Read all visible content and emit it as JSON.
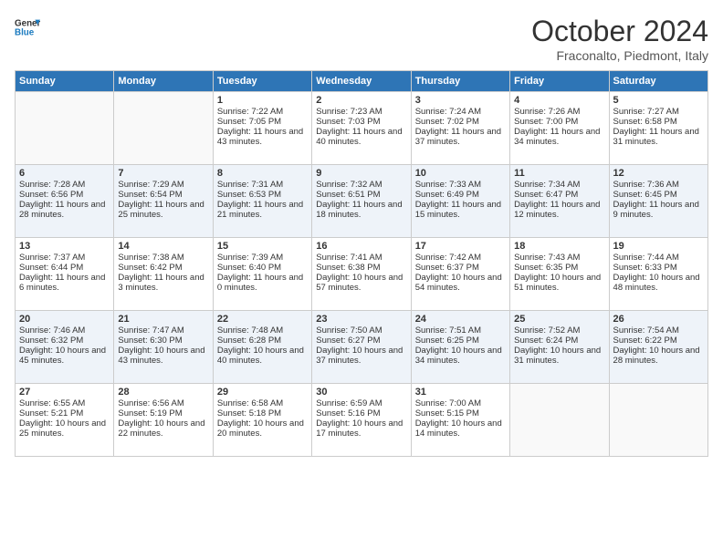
{
  "header": {
    "logo_line1": "General",
    "logo_line2": "Blue",
    "month": "October 2024",
    "location": "Fraconalto, Piedmont, Italy"
  },
  "weekdays": [
    "Sunday",
    "Monday",
    "Tuesday",
    "Wednesday",
    "Thursday",
    "Friday",
    "Saturday"
  ],
  "weeks": [
    [
      {
        "day": "",
        "sunrise": "",
        "sunset": "",
        "daylight": ""
      },
      {
        "day": "",
        "sunrise": "",
        "sunset": "",
        "daylight": ""
      },
      {
        "day": "1",
        "sunrise": "Sunrise: 7:22 AM",
        "sunset": "Sunset: 7:05 PM",
        "daylight": "Daylight: 11 hours and 43 minutes."
      },
      {
        "day": "2",
        "sunrise": "Sunrise: 7:23 AM",
        "sunset": "Sunset: 7:03 PM",
        "daylight": "Daylight: 11 hours and 40 minutes."
      },
      {
        "day": "3",
        "sunrise": "Sunrise: 7:24 AM",
        "sunset": "Sunset: 7:02 PM",
        "daylight": "Daylight: 11 hours and 37 minutes."
      },
      {
        "day": "4",
        "sunrise": "Sunrise: 7:26 AM",
        "sunset": "Sunset: 7:00 PM",
        "daylight": "Daylight: 11 hours and 34 minutes."
      },
      {
        "day": "5",
        "sunrise": "Sunrise: 7:27 AM",
        "sunset": "Sunset: 6:58 PM",
        "daylight": "Daylight: 11 hours and 31 minutes."
      }
    ],
    [
      {
        "day": "6",
        "sunrise": "Sunrise: 7:28 AM",
        "sunset": "Sunset: 6:56 PM",
        "daylight": "Daylight: 11 hours and 28 minutes."
      },
      {
        "day": "7",
        "sunrise": "Sunrise: 7:29 AM",
        "sunset": "Sunset: 6:54 PM",
        "daylight": "Daylight: 11 hours and 25 minutes."
      },
      {
        "day": "8",
        "sunrise": "Sunrise: 7:31 AM",
        "sunset": "Sunset: 6:53 PM",
        "daylight": "Daylight: 11 hours and 21 minutes."
      },
      {
        "day": "9",
        "sunrise": "Sunrise: 7:32 AM",
        "sunset": "Sunset: 6:51 PM",
        "daylight": "Daylight: 11 hours and 18 minutes."
      },
      {
        "day": "10",
        "sunrise": "Sunrise: 7:33 AM",
        "sunset": "Sunset: 6:49 PM",
        "daylight": "Daylight: 11 hours and 15 minutes."
      },
      {
        "day": "11",
        "sunrise": "Sunrise: 7:34 AM",
        "sunset": "Sunset: 6:47 PM",
        "daylight": "Daylight: 11 hours and 12 minutes."
      },
      {
        "day": "12",
        "sunrise": "Sunrise: 7:36 AM",
        "sunset": "Sunset: 6:45 PM",
        "daylight": "Daylight: 11 hours and 9 minutes."
      }
    ],
    [
      {
        "day": "13",
        "sunrise": "Sunrise: 7:37 AM",
        "sunset": "Sunset: 6:44 PM",
        "daylight": "Daylight: 11 hours and 6 minutes."
      },
      {
        "day": "14",
        "sunrise": "Sunrise: 7:38 AM",
        "sunset": "Sunset: 6:42 PM",
        "daylight": "Daylight: 11 hours and 3 minutes."
      },
      {
        "day": "15",
        "sunrise": "Sunrise: 7:39 AM",
        "sunset": "Sunset: 6:40 PM",
        "daylight": "Daylight: 11 hours and 0 minutes."
      },
      {
        "day": "16",
        "sunrise": "Sunrise: 7:41 AM",
        "sunset": "Sunset: 6:38 PM",
        "daylight": "Daylight: 10 hours and 57 minutes."
      },
      {
        "day": "17",
        "sunrise": "Sunrise: 7:42 AM",
        "sunset": "Sunset: 6:37 PM",
        "daylight": "Daylight: 10 hours and 54 minutes."
      },
      {
        "day": "18",
        "sunrise": "Sunrise: 7:43 AM",
        "sunset": "Sunset: 6:35 PM",
        "daylight": "Daylight: 10 hours and 51 minutes."
      },
      {
        "day": "19",
        "sunrise": "Sunrise: 7:44 AM",
        "sunset": "Sunset: 6:33 PM",
        "daylight": "Daylight: 10 hours and 48 minutes."
      }
    ],
    [
      {
        "day": "20",
        "sunrise": "Sunrise: 7:46 AM",
        "sunset": "Sunset: 6:32 PM",
        "daylight": "Daylight: 10 hours and 45 minutes."
      },
      {
        "day": "21",
        "sunrise": "Sunrise: 7:47 AM",
        "sunset": "Sunset: 6:30 PM",
        "daylight": "Daylight: 10 hours and 43 minutes."
      },
      {
        "day": "22",
        "sunrise": "Sunrise: 7:48 AM",
        "sunset": "Sunset: 6:28 PM",
        "daylight": "Daylight: 10 hours and 40 minutes."
      },
      {
        "day": "23",
        "sunrise": "Sunrise: 7:50 AM",
        "sunset": "Sunset: 6:27 PM",
        "daylight": "Daylight: 10 hours and 37 minutes."
      },
      {
        "day": "24",
        "sunrise": "Sunrise: 7:51 AM",
        "sunset": "Sunset: 6:25 PM",
        "daylight": "Daylight: 10 hours and 34 minutes."
      },
      {
        "day": "25",
        "sunrise": "Sunrise: 7:52 AM",
        "sunset": "Sunset: 6:24 PM",
        "daylight": "Daylight: 10 hours and 31 minutes."
      },
      {
        "day": "26",
        "sunrise": "Sunrise: 7:54 AM",
        "sunset": "Sunset: 6:22 PM",
        "daylight": "Daylight: 10 hours and 28 minutes."
      }
    ],
    [
      {
        "day": "27",
        "sunrise": "Sunrise: 6:55 AM",
        "sunset": "Sunset: 5:21 PM",
        "daylight": "Daylight: 10 hours and 25 minutes."
      },
      {
        "day": "28",
        "sunrise": "Sunrise: 6:56 AM",
        "sunset": "Sunset: 5:19 PM",
        "daylight": "Daylight: 10 hours and 22 minutes."
      },
      {
        "day": "29",
        "sunrise": "Sunrise: 6:58 AM",
        "sunset": "Sunset: 5:18 PM",
        "daylight": "Daylight: 10 hours and 20 minutes."
      },
      {
        "day": "30",
        "sunrise": "Sunrise: 6:59 AM",
        "sunset": "Sunset: 5:16 PM",
        "daylight": "Daylight: 10 hours and 17 minutes."
      },
      {
        "day": "31",
        "sunrise": "Sunrise: 7:00 AM",
        "sunset": "Sunset: 5:15 PM",
        "daylight": "Daylight: 10 hours and 14 minutes."
      },
      {
        "day": "",
        "sunrise": "",
        "sunset": "",
        "daylight": ""
      },
      {
        "day": "",
        "sunrise": "",
        "sunset": "",
        "daylight": ""
      }
    ]
  ]
}
